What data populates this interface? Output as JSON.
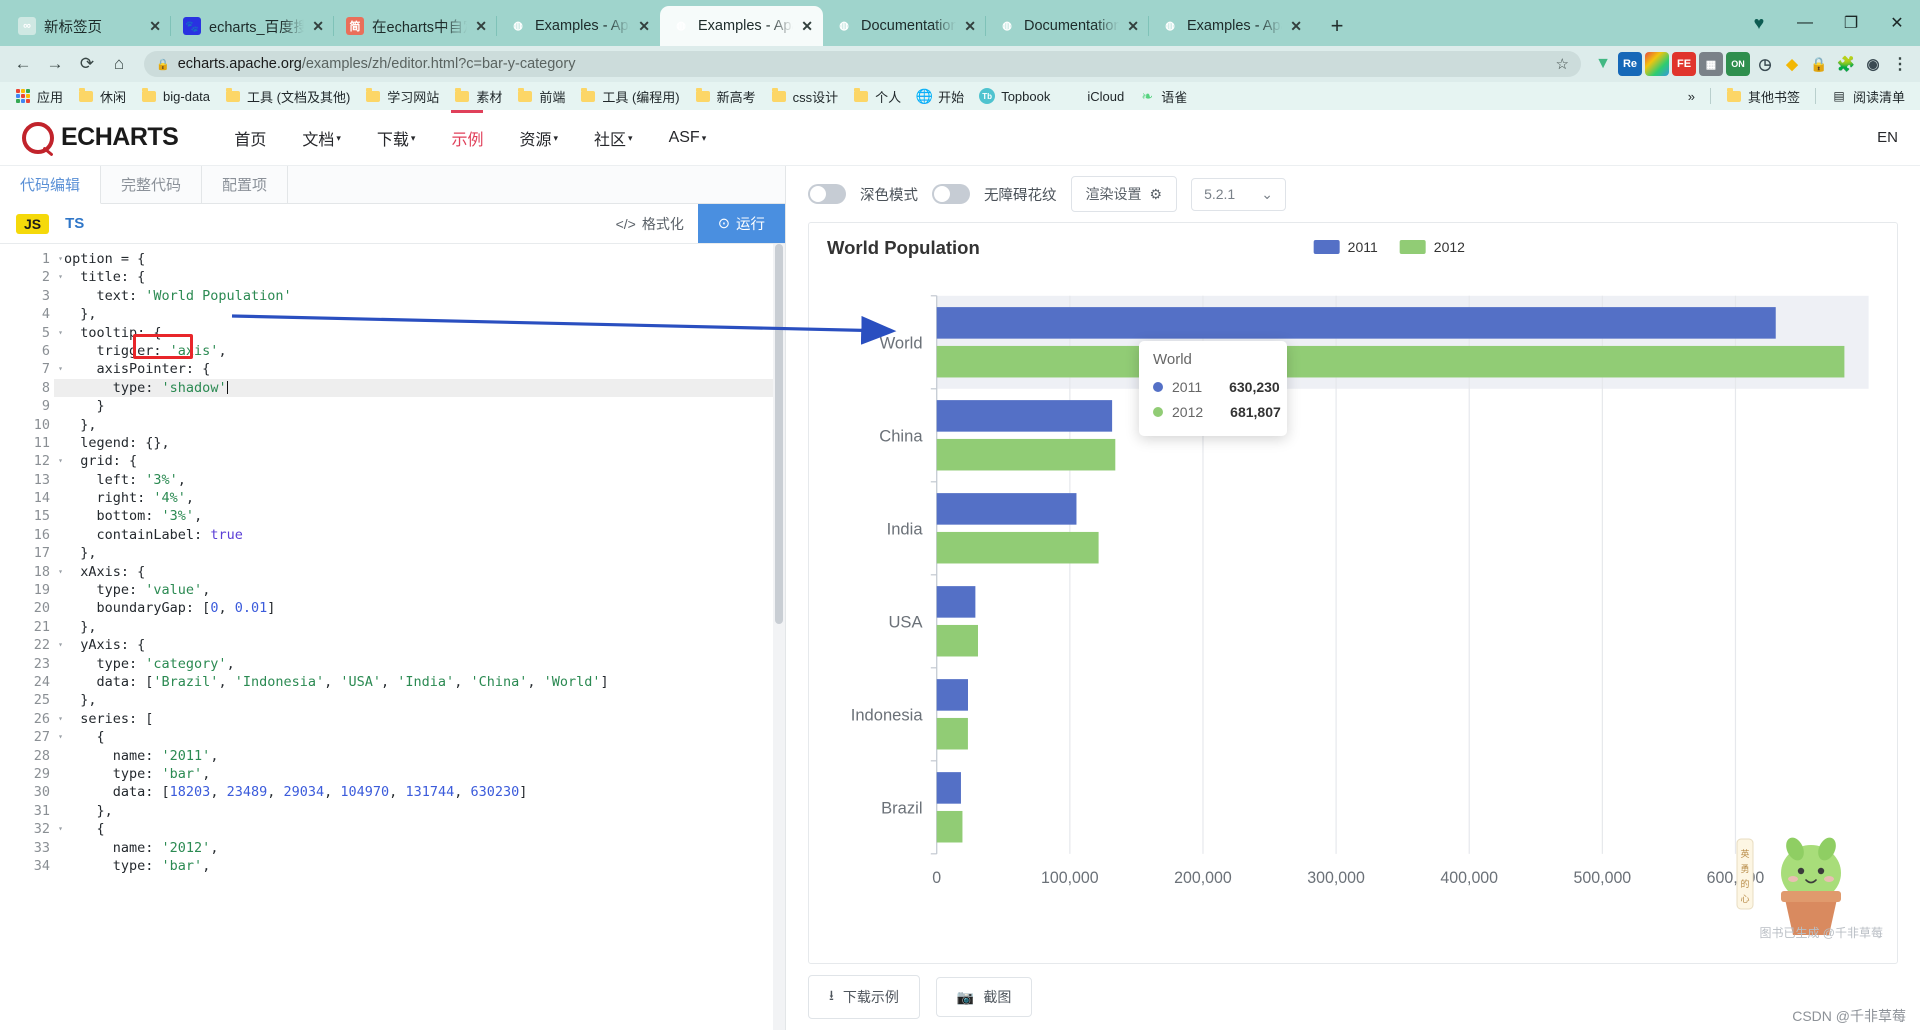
{
  "browser": {
    "tabs": [
      {
        "title": "新标签页",
        "favicon": "newtab-icon",
        "active": false
      },
      {
        "title": "echarts_百度搜索",
        "favicon": "baidu-icon",
        "active": false
      },
      {
        "title": "在echarts中自定",
        "favicon": "jianshu-icon",
        "active": false
      },
      {
        "title": "Examples - Apac",
        "favicon": "echarts-icon",
        "active": false
      },
      {
        "title": "Examples - Apac",
        "favicon": "echarts-icon",
        "active": true
      },
      {
        "title": "Documentation",
        "favicon": "echarts-icon",
        "active": false
      },
      {
        "title": "Documentation",
        "favicon": "echarts-icon",
        "active": false
      },
      {
        "title": "Examples - Apac",
        "favicon": "echarts-icon",
        "active": false
      }
    ],
    "tab_close_label": "✕",
    "new_tab_label": "+",
    "window_controls": {
      "heart": "♥",
      "minimize": "—",
      "maximize": "❐",
      "close": "✕"
    },
    "nav": {
      "back": "←",
      "forward": "→",
      "reload": "⟳",
      "home": "⌂"
    },
    "address": {
      "lock_icon": "lock-icon",
      "host": "echarts.apache.org",
      "path": "/examples/zh/editor.html?c=bar-y-category",
      "star_icon": "star-icon"
    },
    "extensions": [
      "vue-devtools",
      "Re",
      "colorpicker",
      "FE",
      "unknown-1",
      "unknown-2",
      "clock",
      "shield",
      "lock",
      "puzzle",
      "profile"
    ],
    "bookmarks": [
      {
        "label": "应用",
        "icon": "apps-grid-icon"
      },
      {
        "label": "休闲",
        "icon": "folder-icon"
      },
      {
        "label": "big-data",
        "icon": "folder-icon"
      },
      {
        "label": "工具 (文档及其他)",
        "icon": "folder-icon"
      },
      {
        "label": "学习网站",
        "icon": "folder-icon"
      },
      {
        "label": "素材",
        "icon": "folder-icon"
      },
      {
        "label": "前端",
        "icon": "folder-icon"
      },
      {
        "label": "工具 (编程用)",
        "icon": "folder-icon"
      },
      {
        "label": "新高考",
        "icon": "folder-icon"
      },
      {
        "label": "css设计",
        "icon": "folder-icon"
      },
      {
        "label": "个人",
        "icon": "folder-icon"
      },
      {
        "label": "开始",
        "icon": "globe-icon"
      },
      {
        "label": "Topbook",
        "icon": "topbook-icon"
      },
      {
        "label": "iCloud",
        "icon": "apple-icon"
      },
      {
        "label": "语雀",
        "icon": "yuque-icon"
      }
    ],
    "bookmarks_overflow": "»",
    "bookmarks_right": [
      {
        "label": "其他书签",
        "icon": "folder-icon"
      },
      {
        "label": "阅读清单",
        "icon": "readinglist-icon"
      }
    ]
  },
  "site": {
    "logo_text": "ECHARTS",
    "nav": [
      {
        "label": "首页",
        "has_caret": false,
        "active": false
      },
      {
        "label": "文档",
        "has_caret": true,
        "active": false
      },
      {
        "label": "下载",
        "has_caret": true,
        "active": false
      },
      {
        "label": "示例",
        "has_caret": false,
        "active": true
      },
      {
        "label": "资源",
        "has_caret": true,
        "active": false
      },
      {
        "label": "社区",
        "has_caret": true,
        "active": false
      },
      {
        "label": "ASF",
        "has_caret": true,
        "active": false
      }
    ],
    "lang": "EN",
    "caret_glyph": "▾"
  },
  "editor": {
    "tabs": [
      {
        "label": "代码编辑",
        "active": true
      },
      {
        "label": "完整代码",
        "active": false
      },
      {
        "label": "配置项",
        "active": false
      }
    ],
    "lang_js": "JS",
    "lang_ts": "TS",
    "format_label": "格式化",
    "format_icon": "code-brackets-icon",
    "run_label": "运行",
    "run_icon": "play-icon",
    "highlight_line": 8,
    "lines": [
      {
        "n": 1,
        "fold": true,
        "text": "option = {"
      },
      {
        "n": 2,
        "fold": true,
        "text": "  title: {"
      },
      {
        "n": 3,
        "fold": false,
        "text": "    text: 'World Population'"
      },
      {
        "n": 4,
        "fold": false,
        "text": "  },"
      },
      {
        "n": 5,
        "fold": true,
        "text": "  tooltip: {"
      },
      {
        "n": 6,
        "fold": false,
        "text": "    trigger: 'axis',"
      },
      {
        "n": 7,
        "fold": true,
        "text": "    axisPointer: {"
      },
      {
        "n": 8,
        "fold": false,
        "text": "      type: 'shadow'"
      },
      {
        "n": 9,
        "fold": false,
        "text": "    }"
      },
      {
        "n": 10,
        "fold": false,
        "text": "  },"
      },
      {
        "n": 11,
        "fold": false,
        "text": "  legend: {},"
      },
      {
        "n": 12,
        "fold": true,
        "text": "  grid: {"
      },
      {
        "n": 13,
        "fold": false,
        "text": "    left: '3%',"
      },
      {
        "n": 14,
        "fold": false,
        "text": "    right: '4%',"
      },
      {
        "n": 15,
        "fold": false,
        "text": "    bottom: '3%',"
      },
      {
        "n": 16,
        "fold": false,
        "text": "    containLabel: true"
      },
      {
        "n": 17,
        "fold": false,
        "text": "  },"
      },
      {
        "n": 18,
        "fold": true,
        "text": "  xAxis: {"
      },
      {
        "n": 19,
        "fold": false,
        "text": "    type: 'value',"
      },
      {
        "n": 20,
        "fold": false,
        "text": "    boundaryGap: [0, 0.01]"
      },
      {
        "n": 21,
        "fold": false,
        "text": "  },"
      },
      {
        "n": 22,
        "fold": true,
        "text": "  yAxis: {"
      },
      {
        "n": 23,
        "fold": false,
        "text": "    type: 'category',"
      },
      {
        "n": 24,
        "fold": false,
        "text": "    data: ['Brazil', 'Indonesia', 'USA', 'India', 'China', 'World']"
      },
      {
        "n": 25,
        "fold": false,
        "text": "  },"
      },
      {
        "n": 26,
        "fold": true,
        "text": "  series: ["
      },
      {
        "n": 27,
        "fold": true,
        "text": "    {"
      },
      {
        "n": 28,
        "fold": false,
        "text": "      name: '2011',"
      },
      {
        "n": 29,
        "fold": false,
        "text": "      type: 'bar',"
      },
      {
        "n": 30,
        "fold": false,
        "text": "      data: [18203, 23489, 29034, 104970, 131744, 630230]"
      },
      {
        "n": 31,
        "fold": false,
        "text": "    },"
      },
      {
        "n": 32,
        "fold": true,
        "text": "    {"
      },
      {
        "n": 33,
        "fold": false,
        "text": "      name: '2012',"
      },
      {
        "n": 34,
        "fold": false,
        "text": "      type: 'bar',"
      }
    ]
  },
  "preview": {
    "dark_mode_label": "深色模式",
    "accessibility_label": "无障碍花纹",
    "render_settings_label": "渲染设置",
    "render_settings_icon": "gear-icon",
    "version": "5.2.1",
    "version_caret": "⌄",
    "download_label": "下载示例",
    "download_icon": "download-icon",
    "screenshot_label": "截图",
    "screenshot_icon": "camera-icon",
    "watermark_author": "图书已生成 @千非草莓",
    "watermark_csdn": "CSDN @千非草莓"
  },
  "chart_data": {
    "type": "bar",
    "orientation": "horizontal",
    "title": "World Population",
    "xlabel": "",
    "ylabel": "",
    "categories": [
      "Brazil",
      "Indonesia",
      "USA",
      "India",
      "China",
      "World"
    ],
    "display_order_top_to_bottom": [
      "World",
      "China",
      "India",
      "USA",
      "Indonesia",
      "Brazil"
    ],
    "series": [
      {
        "name": "2011",
        "color": "#5470c6",
        "values": [
          18203,
          23489,
          29034,
          104970,
          131744,
          630230
        ]
      },
      {
        "name": "2012",
        "color": "#91cc75",
        "values": [
          19325,
          23438,
          31000,
          121594,
          134141,
          681807
        ]
      }
    ],
    "xlim": [
      0,
      700000
    ],
    "xticks": [
      0,
      100000,
      200000,
      300000,
      400000,
      500000,
      600000
    ],
    "xtick_labels": [
      "0",
      "100,000",
      "200,000",
      "300,000",
      "400,000",
      "500,000",
      "600,000"
    ],
    "grid": true,
    "legend_position": "top-center",
    "axis_pointer": "shadow",
    "tooltip": {
      "visible": true,
      "title": "World",
      "rows": [
        {
          "name": "2011",
          "value": "630,230",
          "color": "#5470c6"
        },
        {
          "name": "2012",
          "value": "681,807",
          "color": "#91cc75"
        }
      ]
    }
  },
  "annotation": {
    "redbox_target": "'axis'",
    "arrow_from": "code-trigger-axis",
    "arrow_to": "chart-shadow-highlight"
  }
}
